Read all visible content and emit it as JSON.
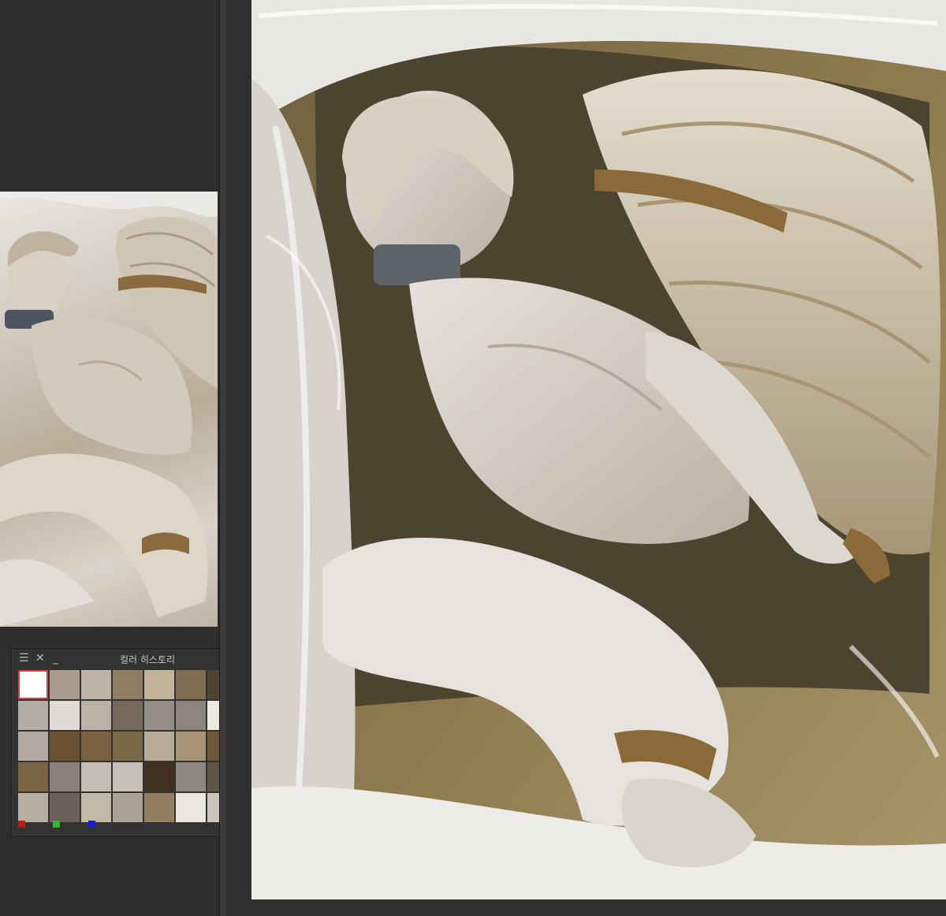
{
  "color_history": {
    "title": "컬러 히스토리",
    "menu_icon": "hamburger-menu-icon",
    "close_icon": "close-icon",
    "minimize_icon": "minimize-icon",
    "swatches": [
      "#ffffff",
      "#a79c8d",
      "#bdb3a6",
      "#8f7d63",
      "#c2b49a",
      "#7f6d52",
      "#4f4331",
      "#a59a8f",
      "#b0aca8",
      "#dedad5",
      "#bdb2a6",
      "#75695b",
      "#958e86",
      "#8c8580",
      "#ece8e2",
      "#a6998a",
      "#b2aaa2",
      "#6a5230",
      "#7a6240",
      "#7a6947",
      "#b8ab98",
      "#a89376",
      "#6b5838",
      "#c7bcaf",
      "#7b6543",
      "#888079",
      "#c2bdb6",
      "#c4bfb7",
      "#3f3020",
      "#8c8680",
      "#5e5548",
      "#b8b1a7",
      "#b6ada3",
      "#6b6159",
      "#c2b8a8",
      "#ada394",
      "#927e61",
      "#e9e6e0",
      "#cac6bd",
      "#8b7f6c"
    ],
    "channel_colors": [
      "#c01818",
      "#2db52d",
      "#1a1ae0"
    ]
  }
}
